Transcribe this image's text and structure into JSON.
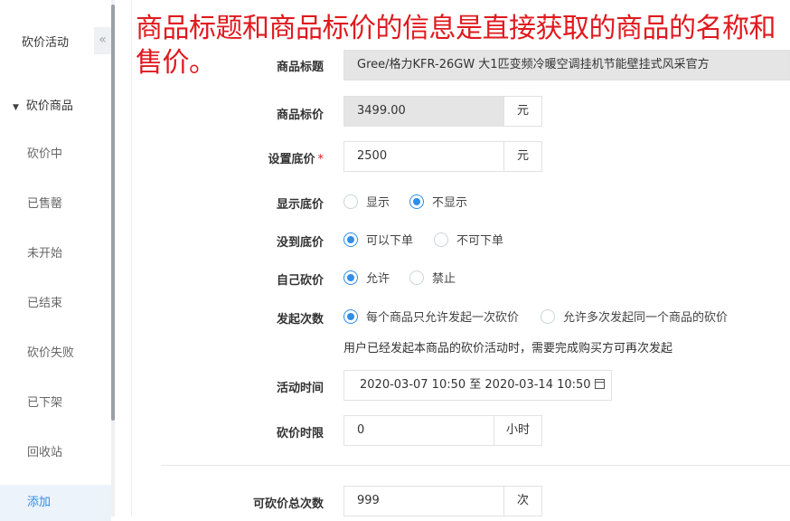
{
  "sidebar": {
    "title": "砍价活动",
    "collapse_icon": "«",
    "group_label": "砍价商品",
    "group_caret": "▼",
    "items": [
      {
        "label": "砍价中"
      },
      {
        "label": "已售罄"
      },
      {
        "label": "未开始"
      },
      {
        "label": "已结束"
      },
      {
        "label": "砍价失败"
      },
      {
        "label": "已下架"
      },
      {
        "label": "回收站"
      },
      {
        "label": "添加"
      }
    ]
  },
  "annotation": "商品标题和商品标价的信息是直接获取的商品的名称和售价。",
  "form": {
    "title_label": "商品标题",
    "title_value": "Gree/格力KFR-26GW 大1匹变频冷暖空调挂机节能壁挂式风采官方",
    "price_label": "商品标价",
    "price_value": "3499.00",
    "price_unit": "元",
    "floor_label": "设置底价",
    "floor_required": "*",
    "floor_value": "2500",
    "floor_unit": "元",
    "show_floor_label": "显示底价",
    "show_floor_options": [
      "显示",
      "不显示"
    ],
    "no_floor_label": "没到底价",
    "no_floor_options": [
      "可以下单",
      "不可下单"
    ],
    "self_cut_label": "自己砍价",
    "self_cut_options": [
      "允许",
      "禁止"
    ],
    "launch_label": "发起次数",
    "launch_options": [
      "每个商品只允许发起一次砍价",
      "允许多次发起同一个商品的砍价"
    ],
    "launch_hint": "用户已经发起本商品的砍价活动时，需要完成购买方可再次发起",
    "time_label": "活动时间",
    "time_value": "2020-03-07 10:50 至 2020-03-14 10:50",
    "limit_label": "砍价时限",
    "limit_value": "0",
    "limit_unit": "小时",
    "total_label": "可砍价总次数",
    "total_value": "999",
    "total_unit": "次"
  },
  "colors": {
    "accent": "#2f8ee8",
    "annotation": "#e0191e",
    "disabled_bg": "#e5e5e5"
  }
}
